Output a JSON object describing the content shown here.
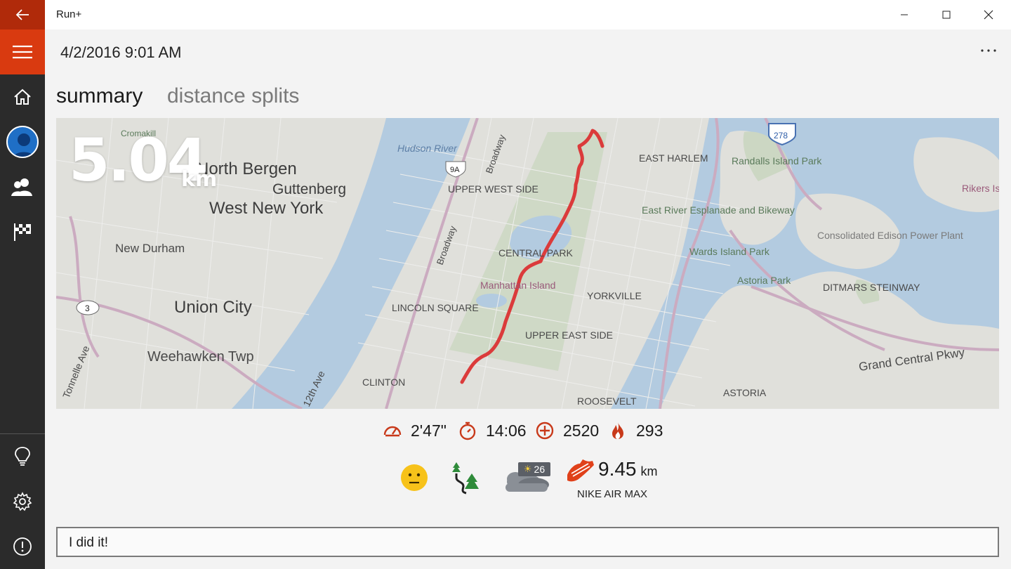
{
  "window": {
    "title": "Run+"
  },
  "run": {
    "datetime": "4/2/2016 9:01 AM",
    "distance_value": "5.04",
    "distance_unit": "km"
  },
  "tabs": [
    {
      "label": "summary",
      "active": true
    },
    {
      "label": "distance splits",
      "active": false
    }
  ],
  "stats": {
    "pace": "2'47\"",
    "duration": "14:06",
    "elevation": "2520",
    "calories": "293"
  },
  "extras": {
    "mood_icon": "neutral-face-icon",
    "terrain_icon": "trail-terrain-icon",
    "weather_icon": "partly-cloudy-icon",
    "temperature": "26",
    "shoe_icon": "running-shoe-icon",
    "shoe_distance": "9.45",
    "shoe_unit": "km",
    "shoe_name": "NIKE AIR MAX"
  },
  "note": {
    "text": "I did it!"
  },
  "map_labels": {
    "north_bergen": "North Bergen",
    "west_new_york": "West New York",
    "guttenberg": "Guttenberg",
    "new_durham": "New Durham",
    "union_city": "Union City",
    "weehawken": "Weehawken Twp",
    "hudson_river": "Hudson River",
    "upper_west_side": "UPPER WEST SIDE",
    "central_park": "CENTRAL PARK",
    "manhattan": "Manhattan Island",
    "lincoln_square": "LINCOLN SQUARE",
    "clinton": "CLINTON",
    "upper_east_side": "UPPER EAST SIDE",
    "yorkville": "YORKVILLE",
    "east_harlem": "EAST HARLEM",
    "randalls": "Randalls Island Park",
    "east_river": "East River Esplanade and Bikeway",
    "wards": "Wards Island Park",
    "astoria_park": "Astoria Park",
    "rikers": "Rikers Island",
    "consolidated": "Consolidated Edison Power Plant",
    "ditmars": "DITMARS STEINWAY",
    "grand_central": "Grand Central Pkwy",
    "astoria": "ASTORIA",
    "roosevelt": "ROOSEVELT",
    "broadway": "Broadway",
    "twelfth_ave": "12th Ave",
    "tonnelle": "Tonnelle Ave",
    "route_9a": "9A",
    "route_3": "3",
    "route_278": "278",
    "cromakill": "Cromakill"
  },
  "colors": {
    "accent": "#d93a10",
    "accent_dark": "#b02a0a",
    "sidebar": "#2b2b2b",
    "route": "#d62020",
    "stat_icon": "#c8391a"
  }
}
